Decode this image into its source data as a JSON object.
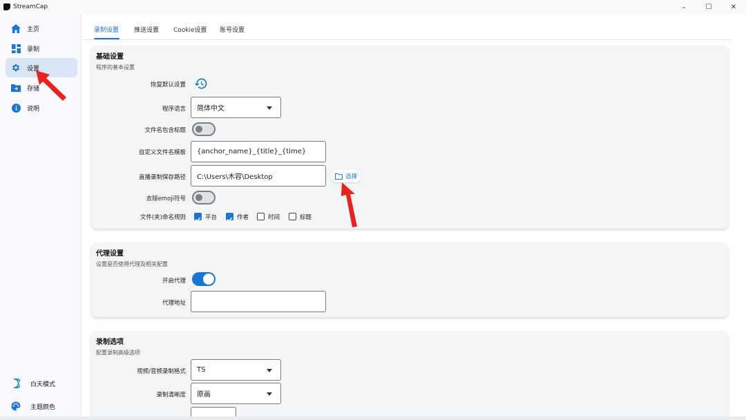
{
  "app": {
    "title": "StreamCap"
  },
  "window": {
    "minimize": "–",
    "maximize": "☐",
    "close": "✕"
  },
  "sidebar": {
    "items": [
      {
        "label": "主页",
        "icon": "home-icon"
      },
      {
        "label": "录制",
        "icon": "dashboard-icon"
      },
      {
        "label": "设置",
        "icon": "gear-icon",
        "active": true
      },
      {
        "label": "存储",
        "icon": "folder-icon"
      },
      {
        "label": "说明",
        "icon": "info-icon"
      }
    ],
    "bottom": [
      {
        "label": "白天模式",
        "icon": "moon-icon"
      },
      {
        "label": "主题颜色",
        "icon": "palette-icon"
      }
    ]
  },
  "tabs": [
    {
      "label": "录制设置",
      "active": true
    },
    {
      "label": "推送设置"
    },
    {
      "label": "Cookie设置"
    },
    {
      "label": "账号设置"
    }
  ],
  "basic": {
    "title": "基础设置",
    "subtitle": "程序的基本设置",
    "reset_label": "恢复默认设置",
    "language_label": "程序语言",
    "language_value": "简体中文",
    "filename_title_label": "文件名包含标题",
    "filename_title_on": false,
    "template_label": "自定义文件名模板",
    "template_value": "{anchor_name}_{title}_{time}",
    "path_label": "直播录制保存路径",
    "path_value": "C:\\Users\\木容\\Desktop",
    "select_label": "选择",
    "emoji_label": "去除emoji符号",
    "emoji_on": false,
    "naming_label": "文件(夹)命名规则",
    "naming_options": [
      {
        "label": "平台",
        "checked": true
      },
      {
        "label": "作者",
        "checked": true
      },
      {
        "label": "时间",
        "checked": false
      },
      {
        "label": "标题",
        "checked": false
      }
    ]
  },
  "proxy": {
    "title": "代理设置",
    "subtitle": "设置是否使用代理及相关配置",
    "enable_label": "开启代理",
    "enable_on": true,
    "address_label": "代理地址",
    "address_value": ""
  },
  "record": {
    "title": "录制选项",
    "subtitle": "配置录制高级选项",
    "format_label": "视频/音频录制格式",
    "format_value": "TS",
    "quality_label": "录制清晰度",
    "quality_value": "原画"
  },
  "colors": {
    "accent": "#1976d2",
    "annotation_arrow": "#e8231c",
    "sidebar_active": "#d9e5f4"
  }
}
